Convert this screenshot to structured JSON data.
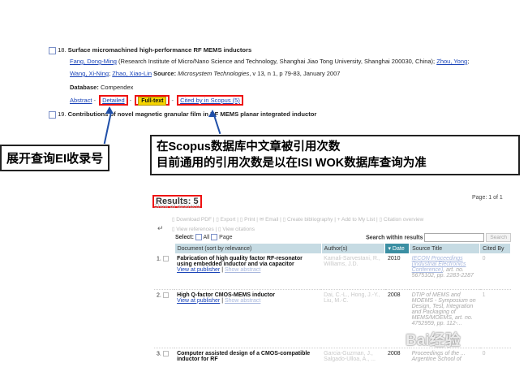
{
  "record18": {
    "number": "18.",
    "title": "Surface micromachined high-performance RF MEMS inductors",
    "author1": "Fang, Dong-Ming",
    "affiliation": " (Research Institute of Micro/Nano Science and Technology, Shanghai Jiao Tong University, Shanghai 200030, China);",
    "author2": "Zhou, Yong",
    "author3": "Wang, Xi-Ning",
    "author4": "Zhao, Xiao-Lin",
    "source_label": "Source:",
    "source_journal": "Microsystem Technologies",
    "source_detail": ", v 13, n 1, p 79-83, January 2007",
    "database_label": "Database:",
    "database_value": "Compendex",
    "link_abstract": "Abstract",
    "link_detailed": "Detailed",
    "link_fulltext": "Full-text",
    "link_cited": "Cited by in Scopus (5)"
  },
  "record19": {
    "number": "19.",
    "title": "Contributions of novel magnetic granular film in RF MEMS planar integrated inductor"
  },
  "callouts": {
    "left": "展开查询EI收录号",
    "right_line1": "在Scopus数据库中文章被引用次数",
    "right_line2": "目前通用的引用次数是以在ISI WOK数据库查询为准"
  },
  "results": {
    "title": "Results: 5",
    "show_all": "Show all abstracts",
    "page_label": "Page: 1 of 1",
    "toolbar": {
      "download": "Download PDF",
      "export": "Export",
      "print": "Print",
      "email": "Email",
      "bibliography": "Create bibliography",
      "add_list": "Add to My List",
      "citation_overview": "Citation overview",
      "view_refs": "View references",
      "view_citations": "View citations"
    },
    "select_label": "Select:",
    "select_all": "All",
    "select_page": "Page",
    "search_within": "Search within results",
    "search_button": "Search",
    "headers": {
      "document": "Document (sort by relevance)",
      "authors": "Author(s)",
      "date": "Date",
      "source": "Source Title",
      "cited": "Cited By"
    },
    "rows": [
      {
        "num": "1.",
        "title": "Fabrication of high quality factor RF-resonator using embedded inductor and via capacitor",
        "view_publisher": "View at publisher",
        "show_abstract": "Show abstract",
        "authors": "Kamali-Sarvestani, R., Williams, J.D.",
        "year": "2010",
        "source_title": "IECON Proceedings (Industrial Electronics Conference)",
        "source_detail": ", art. no. 5675102, pp. 2283-2287",
        "cited": "0"
      },
      {
        "num": "2.",
        "title": "High Q-factor CMOS-MEMS inductor",
        "view_publisher": "View at publisher",
        "show_abstract": "Show abstract",
        "authors": "Dai, C.-L., Hong, J.-Y., Liu, M.-C.",
        "year": "2008",
        "source_title": "DTIP of MEMS and MOEMS - Symposium on Design, Test, Integration and Packaging of MEMS/MOEMS",
        "source_detail": ", art. no. 4752959, pp. 112-...",
        "cited": "1"
      },
      {
        "num": "3.",
        "title": "Computer assisted design of a CMOS-compatible inductor for RF",
        "view_publisher": "",
        "show_abstract": "",
        "authors": "Garcia-Guzman, J., Salgado-Ulloa, A., ...",
        "year": "2008",
        "source_title": "Proceedings of the ... Argentine School of",
        "source_detail": "",
        "cited": "0"
      }
    ]
  },
  "watermark": "Bai经验",
  "colors": {
    "link": "#1a44b8",
    "highlight_box": "#e11111",
    "fulltext_bg": "#f5d400",
    "arrow": "#1f4fa8",
    "header_bg": "#c6dbe3",
    "sorted_header": "#3b8fa3"
  }
}
